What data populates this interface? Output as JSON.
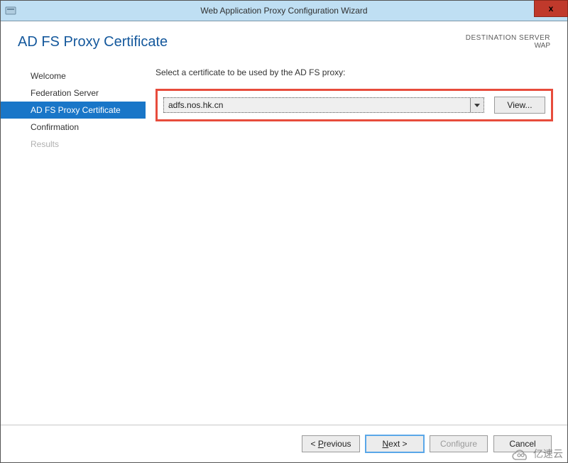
{
  "titlebar": {
    "title": "Web Application Proxy Configuration Wizard",
    "close_label": "x"
  },
  "header": {
    "title": "AD FS Proxy Certificate",
    "destination_label": "DESTINATION SERVER",
    "destination_name": "WAP"
  },
  "sidebar": {
    "items": [
      {
        "label": "Welcome",
        "selected": false,
        "disabled": false
      },
      {
        "label": "Federation Server",
        "selected": false,
        "disabled": false
      },
      {
        "label": "AD FS Proxy Certificate",
        "selected": true,
        "disabled": false
      },
      {
        "label": "Confirmation",
        "selected": false,
        "disabled": false
      },
      {
        "label": "Results",
        "selected": false,
        "disabled": true
      }
    ]
  },
  "content": {
    "prompt": "Select a certificate to be used by the AD FS proxy:",
    "certificate_value": "adfs.nos.hk.cn",
    "view_label": "View..."
  },
  "footer": {
    "previous": "< Previous",
    "next": "Next >",
    "configure": "Configure",
    "cancel": "Cancel"
  },
  "watermark": {
    "text": "亿速云"
  }
}
